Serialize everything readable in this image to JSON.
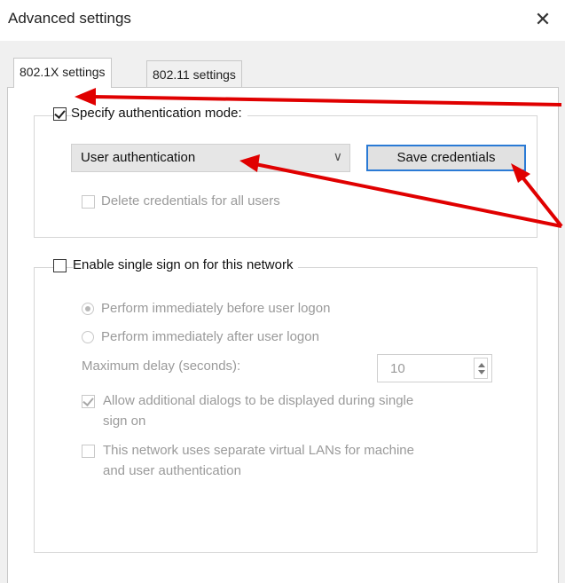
{
  "window": {
    "title": "Advanced settings",
    "close_glyph": "✕"
  },
  "tabs": [
    {
      "label": "802.1X settings",
      "active": true
    },
    {
      "label": "802.11 settings",
      "active": false
    }
  ],
  "auth_group": {
    "specify_label": "Specify authentication mode:",
    "specify_checked": true,
    "mode_value": "User authentication",
    "save_button": "Save credentials",
    "delete_label": "Delete credentials for all users",
    "delete_checked": false
  },
  "sso_group": {
    "enable_label": "Enable single sign on for this network",
    "enable_checked": false,
    "radio_before": "Perform immediately before user logon",
    "radio_after": "Perform immediately after user logon",
    "delay_label": "Maximum delay (seconds):",
    "delay_value": "10",
    "allow_dialogs_line1": "Allow additional dialogs to be displayed during single",
    "allow_dialogs_line2": "sign on",
    "allow_dialogs_checked": true,
    "vlan_line1": "This network uses separate virtual LANs for machine",
    "vlan_line2": "and user authentication",
    "vlan_checked": false
  },
  "annotation_color": "#e00000"
}
